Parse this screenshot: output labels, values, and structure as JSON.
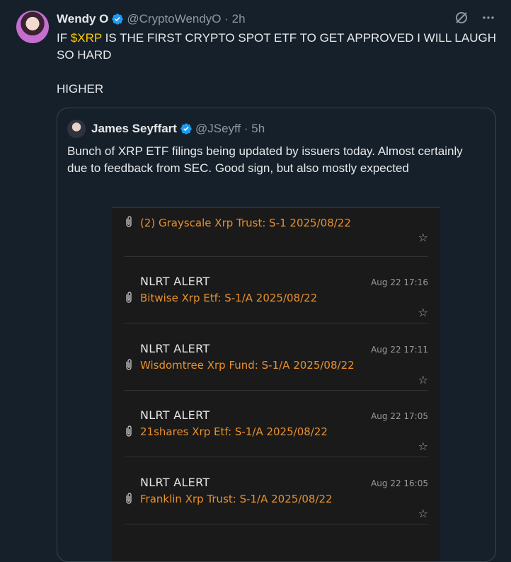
{
  "tweet": {
    "author_name": "Wendy O",
    "handle_time": "@CryptoWendyO · 2h",
    "text_line_pre": "IF ",
    "cashtag": "$XRP",
    "text_line_post": " IS THE FIRST CRYPTO SPOT ETF TO GET APPROVED I WILL LAUGH SO HARD",
    "text_line_2": "HIGHER",
    "icons": [
      "grok-icon",
      "more-icon"
    ]
  },
  "quote": {
    "author_name": "James Seyffart",
    "handle_time": "@JSeyff · 5h",
    "text": "Bunch of XRP ETF filings being updated by issuers today. Almost certainly due to feedback from SEC. Good sign, but also mostly expected"
  },
  "screenshot": {
    "first_item": "(2) Grayscale Xrp Trust: S-1 2025/08/22",
    "alerts": [
      {
        "title": "NLRT ALERT",
        "time": "Aug 22 17:16",
        "link": "Bitwise Xrp Etf: S-1/A 2025/08/22"
      },
      {
        "title": "NLRT ALERT",
        "time": "Aug 22 17:11",
        "link": "Wisdomtree Xrp Fund: S-1/A 2025/08/22"
      },
      {
        "title": "NLRT ALERT",
        "time": "Aug 22 17:05",
        "link": "21shares Xrp Etf: S-1/A 2025/08/22"
      },
      {
        "title": "NLRT ALERT",
        "time": "Aug 22 16:05",
        "link": "Franklin Xrp Trust: S-1/A 2025/08/22"
      }
    ],
    "colors": {
      "link": "#e8902d",
      "background": "#1a1a1a"
    }
  },
  "colors": {
    "background": "#15202b",
    "cashtag": "#ffcc00",
    "verified": "#1d9bf0"
  }
}
